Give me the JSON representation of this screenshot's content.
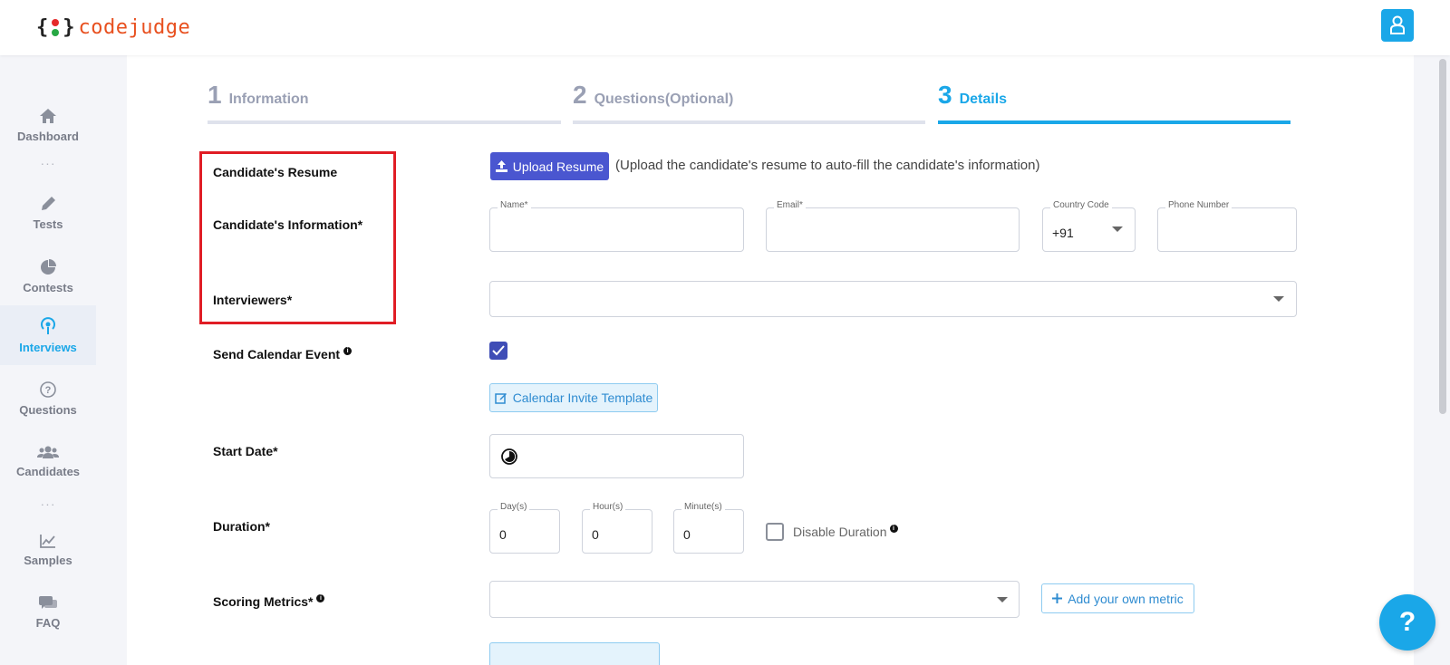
{
  "app": {
    "logo_text": "codejudge",
    "colors": {
      "accent": "#1aa7e8",
      "primary_button": "#4a56d0",
      "highlight": "#e01d25",
      "logo_orange": "#e8501f"
    }
  },
  "sidebar": {
    "items": [
      {
        "label": "Dashboard",
        "icon": "home-icon"
      },
      {
        "label": "Tests",
        "icon": "pen-icon"
      },
      {
        "label": "Contests",
        "icon": "pie-chart-icon"
      },
      {
        "label": "Interviews",
        "icon": "broadcast-icon",
        "active": true
      },
      {
        "label": "Questions",
        "icon": "question-circle-icon"
      },
      {
        "label": "Candidates",
        "icon": "users-icon"
      },
      {
        "label": "Samples",
        "icon": "chart-line-icon"
      },
      {
        "label": "FAQ",
        "icon": "comments-icon"
      }
    ],
    "separator": "···"
  },
  "steps": [
    {
      "number": "1",
      "title": "Information"
    },
    {
      "number": "2",
      "title": "Questions(Optional)"
    },
    {
      "number": "3",
      "title": "Details",
      "active": true
    }
  ],
  "form": {
    "resume_label": "Candidate's Resume",
    "upload_button": "Upload Resume",
    "upload_hint": "(Upload the candidate's resume to auto-fill the candidate's information)",
    "info_label": "Candidate's Information*",
    "name_label": "Name*",
    "name_value": "",
    "email_label": "Email*",
    "email_value": "",
    "country_code_label": "Country Code",
    "country_code_value": "+91",
    "phone_label": "Phone Number",
    "phone_value": "",
    "interviewers_label": "Interviewers*",
    "interviewers_value": "",
    "calendar_label": "Send Calendar Event",
    "calendar_checked": true,
    "calendar_template_button": "Calendar Invite Template",
    "start_date_label": "Start Date*",
    "start_date_value": "",
    "duration_label": "Duration*",
    "days_label": "Day(s)",
    "days_value": "0",
    "hours_label": "Hour(s)",
    "hours_value": "0",
    "minutes_label": "Minute(s)",
    "minutes_value": "0",
    "disable_duration_label": "Disable Duration",
    "disable_duration_checked": false,
    "scoring_label": "Scoring Metrics*",
    "scoring_value": "",
    "add_metric_button": "Add your own metric"
  },
  "help_button": "?"
}
